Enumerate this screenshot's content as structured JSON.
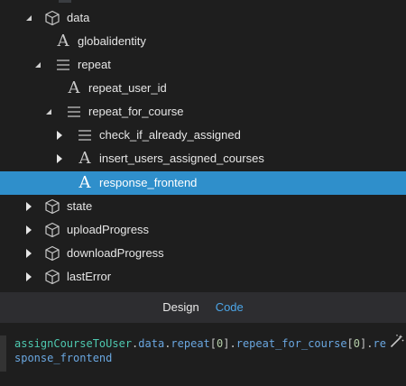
{
  "tree": {
    "items": [
      {
        "label": "data",
        "icon": "cube-icon",
        "expanded": true,
        "depth": 1
      },
      {
        "label": "globalidentity",
        "icon": "text-icon",
        "depth": 2
      },
      {
        "label": "repeat",
        "icon": "list-icon",
        "expanded": true,
        "depth": 2
      },
      {
        "label": "repeat_user_id",
        "icon": "text-icon",
        "depth": 3
      },
      {
        "label": "repeat_for_course",
        "icon": "list-icon",
        "expanded": true,
        "depth": 3
      },
      {
        "label": "check_if_already_assigned",
        "icon": "list-icon",
        "expanded": false,
        "depth": 4
      },
      {
        "label": "insert_users_assigned_courses",
        "icon": "text-icon",
        "expanded": false,
        "depth": 4
      },
      {
        "label": "response_frontend",
        "icon": "text-icon",
        "depth": 4,
        "selected": true
      },
      {
        "label": "state",
        "icon": "cube-icon",
        "expanded": false,
        "depth": 1
      },
      {
        "label": "uploadProgress",
        "icon": "cube-icon",
        "expanded": false,
        "depth": 1
      },
      {
        "label": "downloadProgress",
        "icon": "cube-icon",
        "expanded": false,
        "depth": 1
      },
      {
        "label": "lastError",
        "icon": "cube-icon",
        "expanded": false,
        "depth": 1
      }
    ]
  },
  "tabs": {
    "design": "Design",
    "code": "Code"
  },
  "editor": {
    "tokens": {
      "t0": "assignCourseToUser",
      "t1": ".",
      "t2": "data",
      "t3": ".",
      "t4": "repeat",
      "t5": "[",
      "t6": "0",
      "t7": "]",
      "t8": ".",
      "t9": "repeat_for_course",
      "t10": "[",
      "t11": "0",
      "t12": "]",
      "t13": ".",
      "t14": "response_frontend"
    }
  },
  "colors": {
    "selection": "#2f8fcb",
    "background": "#1e1e1e",
    "tabbar": "#2d2d30",
    "link": "#4ca6e8"
  }
}
